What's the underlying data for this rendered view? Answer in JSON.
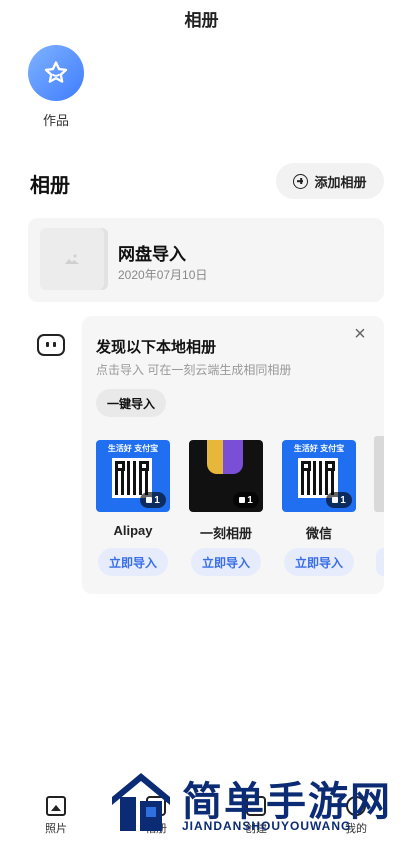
{
  "header": {
    "title": "相册"
  },
  "works": {
    "label": "作品",
    "icon": "star-icon",
    "accent": "#3f7cff"
  },
  "albums": {
    "section_title": "相册",
    "add_button": "添加相册",
    "items": [
      {
        "name": "网盘导入",
        "date": "2020年07月10日"
      }
    ]
  },
  "discover": {
    "title": "发现以下本地相册",
    "subtitle": "点击导入 可在一刻云端生成相同相册",
    "one_key_import": "一键导入",
    "albums": [
      {
        "name": "Alipay",
        "count": "1",
        "banner": "生活好 支付宝",
        "import_label": "立即导入"
      },
      {
        "name": "一刻相册",
        "count": "1",
        "banner": "",
        "import_label": "立即导入"
      },
      {
        "name": "微信",
        "count": "1",
        "banner": "生活好 支付宝",
        "import_label": "立即导入"
      }
    ],
    "import_color": "#3a6ee8"
  },
  "tabbar": {
    "tabs": [
      {
        "label": "照片",
        "icon": "photo-icon"
      },
      {
        "label": "相册",
        "icon": "album-icon"
      },
      {
        "label": "创建",
        "icon": "create-icon"
      },
      {
        "label": "我的",
        "icon": "profile-icon"
      }
    ]
  },
  "watermark": {
    "title": "简单手游网",
    "subtitle": "JIANDANSHOUYOUWANG"
  }
}
